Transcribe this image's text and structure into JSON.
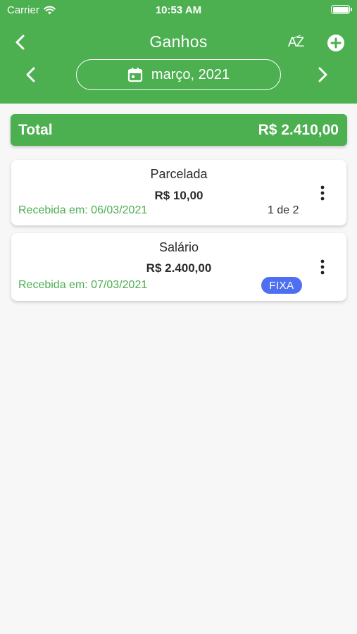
{
  "status": {
    "carrier": "Carrier",
    "time": "10:53 AM"
  },
  "header": {
    "title": "Ganhos",
    "sort_label": "AZ",
    "month_label": "março, 2021",
    "accent_color": "#4caf50"
  },
  "summary": {
    "total_label": "Total",
    "total_value": "R$ 2.410,00"
  },
  "entries": [
    {
      "name": "Parcelada",
      "amount": "R$ 10,00",
      "received_text": "Recebida em: 06/03/2021",
      "installment": "1 de 2"
    },
    {
      "name": "Salário",
      "amount": "R$ 2.400,00",
      "received_text": "Recebida em: 07/03/2021",
      "badge": "FIXA",
      "badge_color": "#4e6ff0"
    }
  ],
  "icons": {
    "back": "chevron-left-icon",
    "sort": "sort-az-icon",
    "add": "plus-circle-icon",
    "prev": "chevron-left-icon",
    "next": "chevron-right-icon",
    "calendar": "calendar-icon",
    "menu": "more-vertical-icon"
  }
}
